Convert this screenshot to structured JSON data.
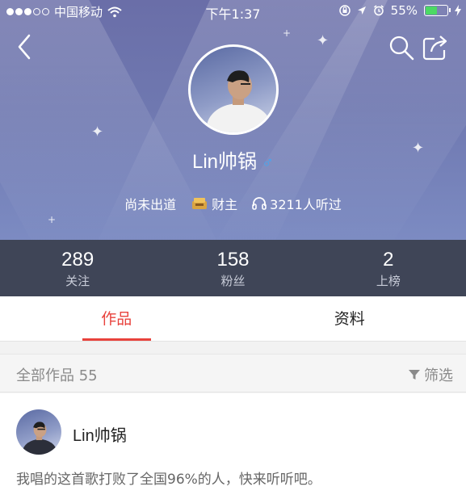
{
  "status_bar": {
    "carrier": "中国移动",
    "time": "下午1:37",
    "battery_percent": "55%",
    "battery_level": 0.55,
    "icons": [
      "signal-dots-icon",
      "wifi-icon",
      "orientation-lock-icon",
      "location-icon",
      "alarm-icon",
      "battery-icon",
      "charging-icon"
    ]
  },
  "nav": {
    "icons": [
      "back-chevron-icon",
      "search-icon",
      "share-icon"
    ]
  },
  "profile": {
    "username": "Lin帅锅",
    "gender_symbol": "♂",
    "tags": [
      {
        "icon": null,
        "text": "尚未出道"
      },
      {
        "icon": "rich-badge-icon",
        "text": "财主"
      },
      {
        "icon": "headphones-icon",
        "text": "3211人听过"
      }
    ]
  },
  "stats": [
    {
      "value": "289",
      "label": "关注"
    },
    {
      "value": "158",
      "label": "粉丝"
    },
    {
      "value": "2",
      "label": "上榜"
    }
  ],
  "tabs": [
    {
      "label": "作品",
      "active": true
    },
    {
      "label": "资料",
      "active": false
    }
  ],
  "works_bar": {
    "count_text": "全部作品 55",
    "filter_label": "筛选"
  },
  "work_item": {
    "author": "Lin帅锅",
    "description": "我唱的这首歌打败了全国96%的人，快来听听吧。"
  },
  "colors": {
    "accent": "#e8423c",
    "header_top": "#6a6ea8",
    "stats_bg": "#3f4557",
    "gender": "#3fa9f5",
    "battery": "#4cd964"
  }
}
